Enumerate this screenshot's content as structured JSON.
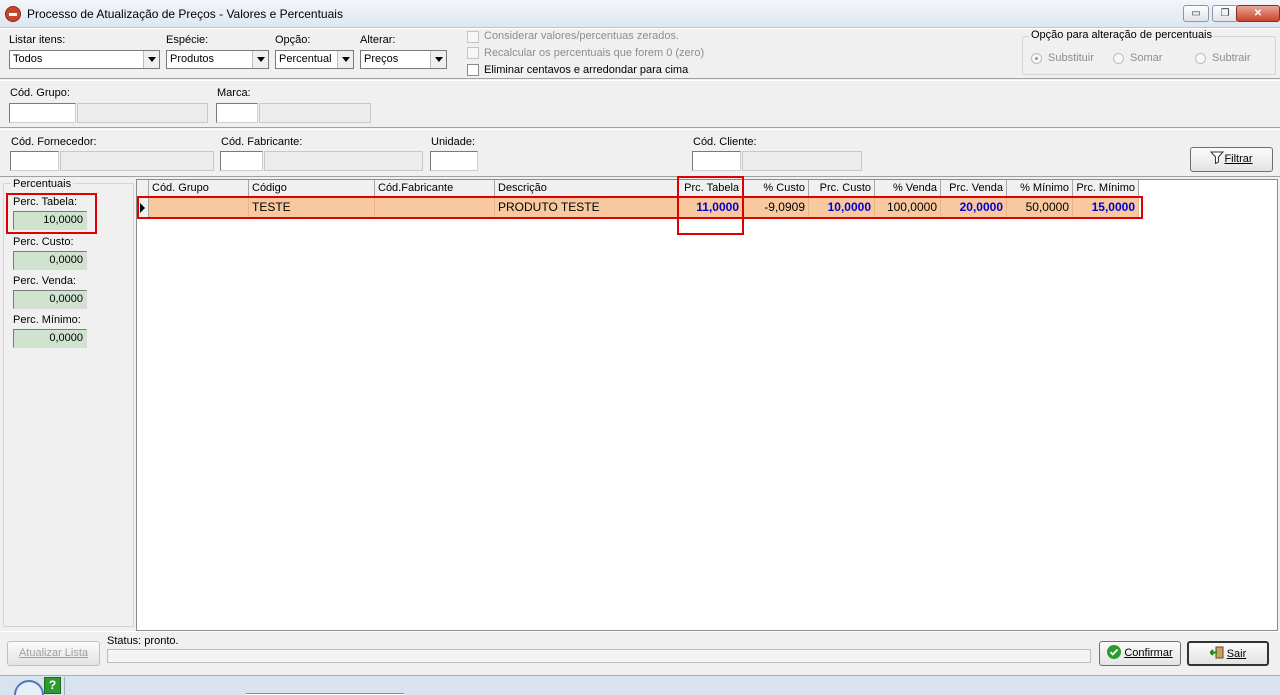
{
  "window": {
    "title": "Processo de Atualização de Preços - Valores e Percentuais",
    "minimize_label": "▭",
    "restore_label": "❐",
    "close_label": "✕"
  },
  "filters": {
    "listar_itens_label": "Listar itens:",
    "listar_itens_value": "Todos",
    "especie_label": "Espécie:",
    "especie_value": "Produtos",
    "opcao_label": "Opção:",
    "opcao_value": "Percentual",
    "alterar_label": "Alterar:",
    "alterar_value": "Preços",
    "chk_considerar": "Considerar valores/percentuas zerados.",
    "chk_recalcular": "Recalcular os percentuais que forem 0 (zero)",
    "chk_eliminar": "Eliminar centavos e arredondar para cima"
  },
  "opcao_percentuais": {
    "title": "Opção para alteração de percentuais",
    "substituir": "Substituir",
    "somar": "Somar",
    "subtrair": "Subtrair"
  },
  "row2": {
    "cod_grupo_label": "Cód. Grupo:",
    "marca_label": "Marca:"
  },
  "row3": {
    "cod_fornecedor_label": "Cód. Fornecedor:",
    "cod_fabricante_label": "Cód. Fabricante:",
    "unidade_label": "Unidade:",
    "cod_cliente_label": "Cód. Cliente:",
    "filtrar_label": "Filtrar"
  },
  "percentuais": {
    "title": "Percentuais",
    "perc_tabela_label": "Perc. Tabela:",
    "perc_tabela_value": "10,0000",
    "perc_custo_label": "Perc. Custo:",
    "perc_custo_value": "0,0000",
    "perc_venda_label": "Perc. Venda:",
    "perc_venda_value": "0,0000",
    "perc_minimo_label": "Perc. Mínimo:",
    "perc_minimo_value": "0,0000"
  },
  "grid": {
    "columns": [
      "Cód. Grupo",
      "Código",
      "Cód.Fabricante",
      "Descrição",
      "Prc. Tabela",
      "% Custo",
      "Prc. Custo",
      "% Venda",
      "Prc. Venda",
      "% Mínimo",
      "Prc. Mínimo"
    ],
    "rows": [
      [
        "",
        "TESTE",
        "",
        "PRODUTO TESTE",
        "11,0000",
        "-9,0909",
        "10,0000",
        "100,0000",
        "20,0000",
        "50,0000",
        "15,0000"
      ]
    ]
  },
  "footer": {
    "atualizar_lista_label": "Atualizar Lista",
    "status_text": "Status: pronto.",
    "confirmar_label": "Confirmar",
    "sair_label": "Sair",
    "help_label": "?"
  },
  "colors": {
    "selected_row": "#f8c89e",
    "highlight_red": "#e00000",
    "bold_value_blue": "#0000d0",
    "percent_field_green": "#cfe3cf"
  }
}
